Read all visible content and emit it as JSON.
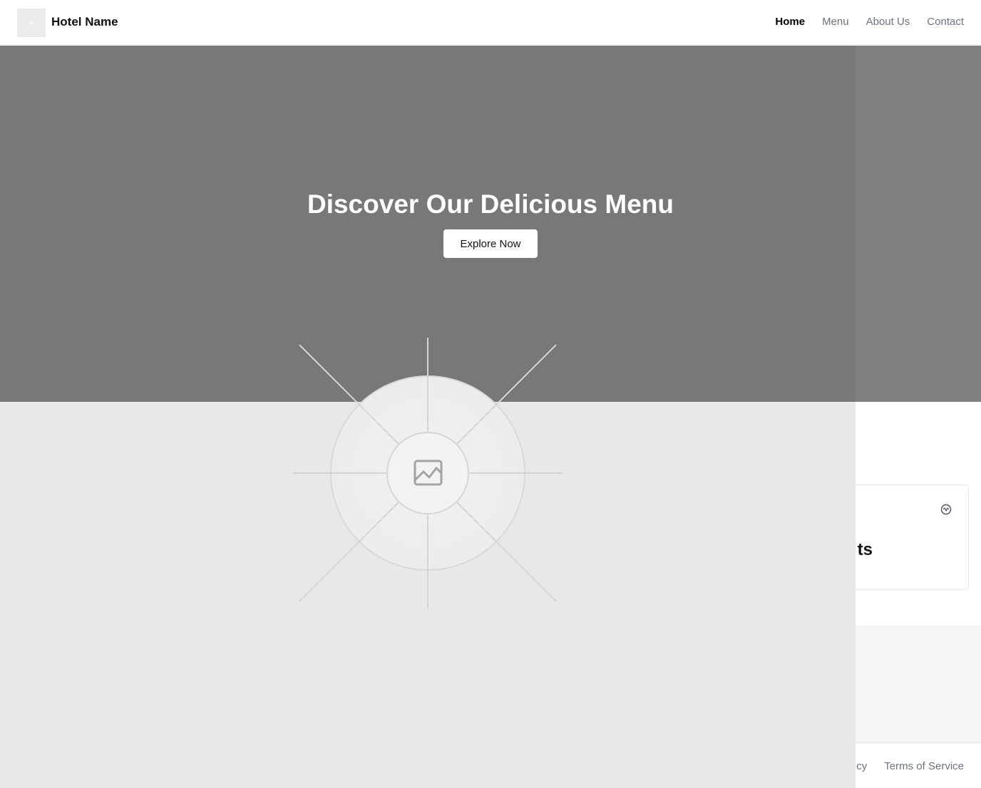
{
  "header": {
    "brand": "Hotel Name",
    "nav": [
      {
        "label": "Home",
        "active": true
      },
      {
        "label": "Menu",
        "active": false
      },
      {
        "label": "About Us",
        "active": false
      },
      {
        "label": "Contact",
        "active": false
      }
    ]
  },
  "hero": {
    "title": "Discover Our Delicious Menu",
    "cta_label": "Explore Now"
  },
  "card": {
    "title_visible_fragment": "ts",
    "icon": "gear-icon"
  },
  "footer": {
    "links": [
      "cy",
      "Terms of Service"
    ]
  },
  "placeholder": {
    "icon": "image-icon"
  },
  "colors": {
    "hero_bg": "#787878",
    "placeholder_bg": "#e8e8e8",
    "band_bg": "#f3f4f6",
    "nav_inactive": "#6b7280"
  }
}
